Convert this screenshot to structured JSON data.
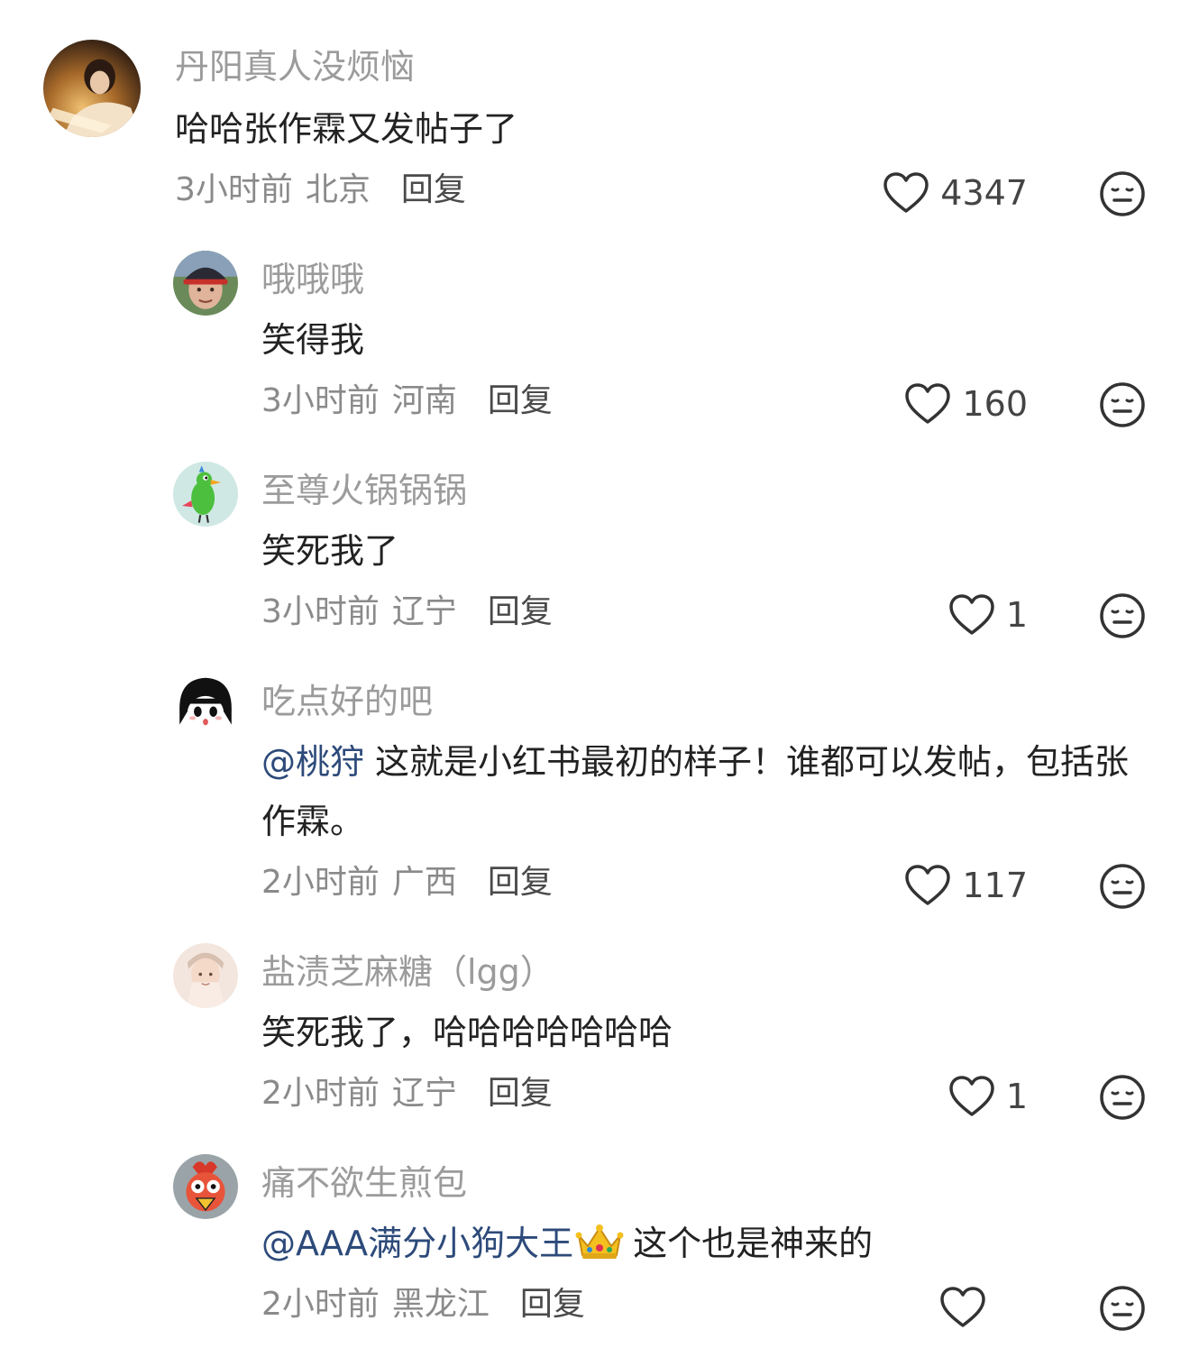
{
  "reply_label": "回复",
  "comments": [
    {
      "username": "丹阳真人没烦恼",
      "text": "哈哈张作霖又发帖子了",
      "time": "3小时前",
      "location": "北京",
      "likes": "4347",
      "avatar": "avatar-photo-woman-writing"
    },
    {
      "username": "哦哦哦",
      "text": "笑得我",
      "time": "3小时前",
      "location": "河南",
      "likes": "160",
      "avatar": "avatar-photo-man-cap"
    },
    {
      "username": "至尊火锅锅锅",
      "text": "笑死我了",
      "time": "3小时前",
      "location": "辽宁",
      "likes": "1",
      "avatar": "avatar-green-bird"
    },
    {
      "username": "吃点好的吧",
      "mention": "@桃狩",
      "text": "这就是小红书最初的样子！谁都可以发帖，包括张作霖。",
      "time": "2小时前",
      "location": "广西",
      "likes": "117",
      "avatar": "avatar-anime-girl"
    },
    {
      "username": "盐渍芝麻糖（lgg）",
      "text": "笑死我了，哈哈哈哈哈哈哈",
      "time": "2小时前",
      "location": "辽宁",
      "likes": "1",
      "avatar": "avatar-photo-person-light"
    },
    {
      "username": "痛不欲生煎包",
      "mention": "@AAA满分小狗大王",
      "text": "这个也是神来的",
      "time": "2小时前",
      "location": "黑龙江",
      "likes": "",
      "avatar": "avatar-cartoon-chicken"
    }
  ],
  "icons": {
    "like": "heart-outline-icon",
    "dislike": "meh-face-icon",
    "crown": "crown-emoji"
  },
  "colors": {
    "username": "#9b9b9b",
    "mention": "#2d4a7a",
    "text": "#222222",
    "meta": "#8a8a8a"
  }
}
